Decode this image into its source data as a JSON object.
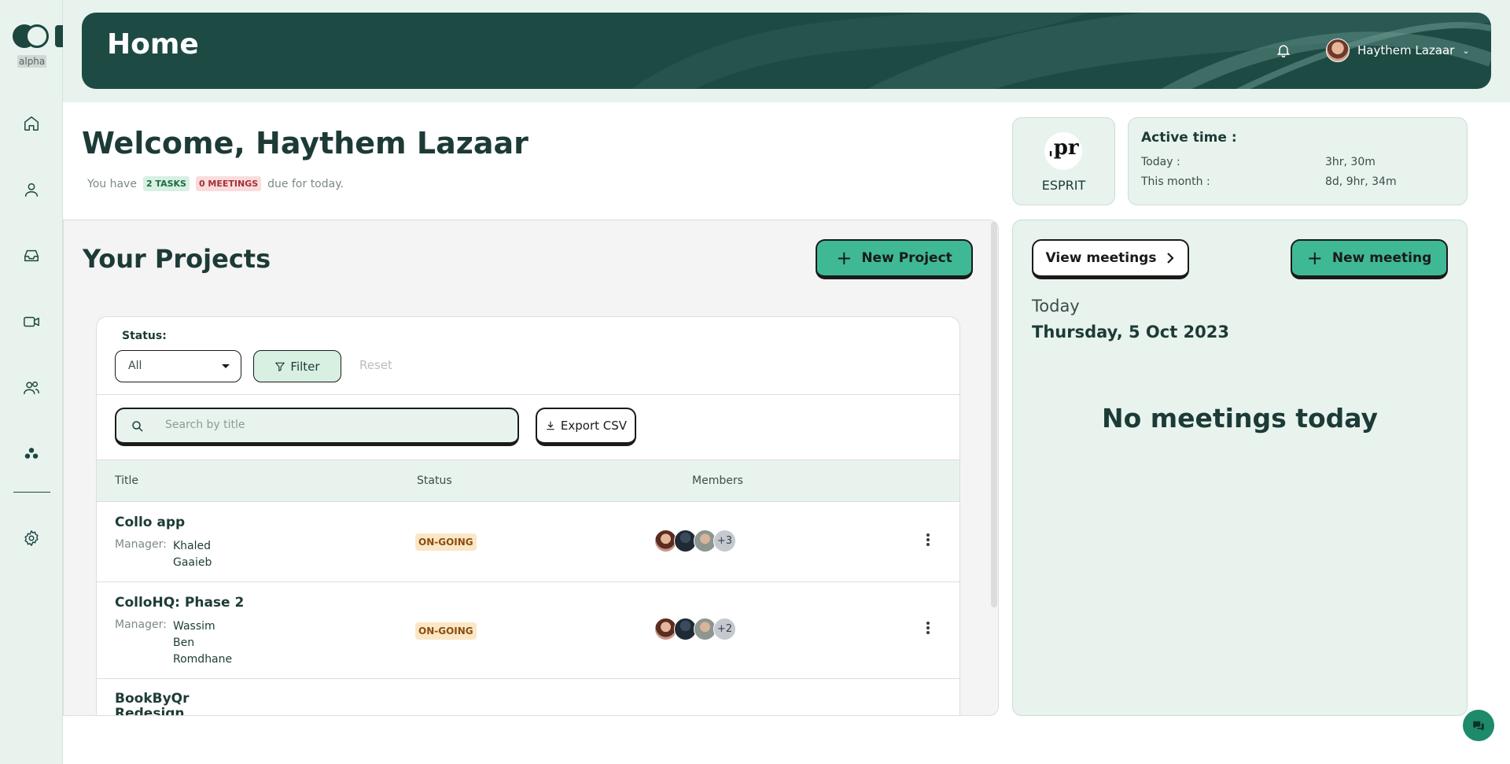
{
  "sidebar": {
    "alpha_label": "alpha",
    "expand_glyph": "›",
    "items": [
      {
        "name": "home-icon"
      },
      {
        "name": "user-icon"
      },
      {
        "name": "inbox-icon"
      },
      {
        "name": "video-icon"
      },
      {
        "name": "team-icon"
      },
      {
        "name": "clusters-icon"
      },
      {
        "name": "gear-icon"
      }
    ]
  },
  "header": {
    "title": "Home",
    "user_name": "Haythem Lazaar"
  },
  "welcome": {
    "heading": "Welcome, Haythem Lazaar",
    "prefix": "You have",
    "tasks_badge": "2 TASKS",
    "meetings_badge": "0 MEETINGS",
    "suffix": "due for today."
  },
  "org": {
    "logo_text": "ˌpr",
    "name": "ESPRIT"
  },
  "active_time": {
    "title": "Active time :",
    "today_label": "Today :",
    "today_value": "3hr, 30m",
    "month_label": "This month :",
    "month_value": "8d, 9hr, 34m"
  },
  "projects": {
    "title": "Your Projects",
    "new_button": "New Project",
    "status_label": "Status:",
    "status_value": "All",
    "filter_button": "Filter",
    "reset_button": "Reset",
    "search_placeholder": "Search by title",
    "export_button": "Export CSV",
    "columns": {
      "title": "Title",
      "status": "Status",
      "members": "Members"
    },
    "rows": [
      {
        "title": "Collo app",
        "manager_label": "Manager:",
        "manager": "Khaled\nGaaieb",
        "status": "ON-GOING",
        "extra": "+3"
      },
      {
        "title": "ColloHQ: Phase 2",
        "manager_label": "Manager:",
        "manager": "Wassim\nBen\nRomdhane",
        "status": "ON-GOING",
        "extra": "+2"
      },
      {
        "title": "BookByQr\nRedesign"
      }
    ]
  },
  "meetings": {
    "view_button": "View meetings",
    "new_button": "New meeting",
    "today_label": "Today",
    "date": "Thursday, 5 Oct 2023",
    "empty_text": "No meetings today"
  },
  "colors": {
    "brand_dark": "#1e4a44",
    "accent": "#3fb995",
    "panel": "#e8f3ee"
  }
}
